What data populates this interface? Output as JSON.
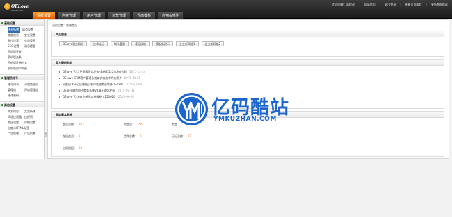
{
  "brand": {
    "name": "OELove",
    "sub": "oelove.com"
  },
  "top_links": [
    "欢迎回来：admin",
    "网站首页",
    "退出登录",
    "更新页面缓存",
    "更新数据缓存"
  ],
  "main_tabs": [
    "系统设置",
    "内容管理",
    "用户管理",
    "运营管理",
    "界面模板",
    "应用&插件"
  ],
  "active_tab_index": 0,
  "sidebar": {
    "groups": [
      {
        "title": "基础设置",
        "items": [
          "系统配置",
          "站点设置",
          "底部信息",
          "安全设置",
          "图片设置",
          "会员设置",
          "SEO设置",
          "消息提醒",
          "手机版开关",
          "手机版关系",
          "手机版注册方式",
          "手机版用户奖励"
        ]
      },
      {
        "title": "管理员帐号",
        "items": [
          "帐号列表",
          "添加管理员",
          "管理组",
          "添加管理组",
          "修改密码"
        ]
      },
      {
        "title": "其他设置",
        "items": [
          "文案内容",
          "文案新增",
          "词语过滤器",
          "违规词",
          "地区设置",
          "户籍设置",
          "自定义HTML标签",
          "广告管理",
          "广告位置"
        ]
      }
    ]
  },
  "breadcrumb": "当前位置：管理首页",
  "products": {
    "title": "产品服务",
    "buttons": [
      "OElove官方网站",
      "技术论坛",
      "联系客服",
      "意见反馈",
      "模板新建示",
      "企业新闻组1",
      "企业新闻组2"
    ]
  },
  "news": {
    "title": "官方最新动态",
    "items": [
      {
        "text": "OElove V3.7免费版正式发布-男新至1224店铺节前",
        "date": "2015-12-24"
      },
      {
        "text": "OELove CRM客户管理系统减价实施中的方案#",
        "date": "2015-11-25"
      },
      {
        "text": "英胜技术研心后盾极小客户管理专业软件OECRM",
        "date": "2015-11-09"
      },
      {
        "text": "OElove婚恋电子商务系统V3.8正式版发布",
        "date": "2015-09-18"
      },
      {
        "text": "OElove V3.6商业新版本升级补丁150626",
        "date": "2015-06-26"
      }
    ]
  },
  "stats": {
    "title": "网站基本数据",
    "items": [
      {
        "label": "会员总数：",
        "value": "342"
      },
      {
        "label": "男会员：",
        "value": "156"
      },
      {
        "label": "女会",
        "value": ""
      },
      {
        "label": "在线会员：",
        "value": "3"
      },
      {
        "label": "信件总数：",
        "value": "0"
      },
      {
        "label": "日记总数：",
        "value": "33"
      },
      {
        "label": "心情播报：",
        "value": "20"
      }
    ]
  },
  "watermark": {
    "cn": "亿码酷站",
    "en": "YMKUZHAN.COM"
  },
  "colors": {
    "accent": "#ff6a00",
    "watermark": "#1a66ce",
    "sidebar_active": "#2f6eb5"
  }
}
